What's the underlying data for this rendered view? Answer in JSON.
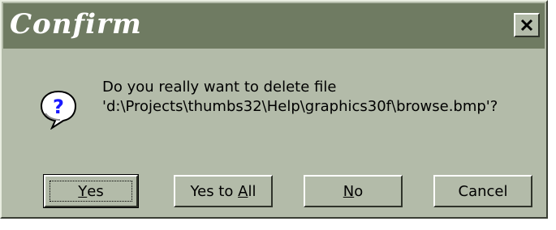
{
  "dialog": {
    "title": "Confirm",
    "close_icon": "close-icon",
    "message_icon": "question-icon",
    "message_line1": "Do you really want to delete file",
    "message_line2": "'d:\\Projects\\thumbs32\\Help\\graphics30f\\browse.bmp'?",
    "colors": {
      "face": "#b3bba9",
      "titlebar": "#6f7b62",
      "title_text": "#ffffff"
    }
  },
  "buttons": {
    "yes": {
      "mnemonic": "Y",
      "rest": "es"
    },
    "yes_to_all": {
      "prefix": "Yes to ",
      "mnemonic": "A",
      "rest": "ll"
    },
    "no": {
      "mnemonic": "N",
      "rest": "o"
    },
    "cancel": {
      "label": "Cancel"
    }
  }
}
